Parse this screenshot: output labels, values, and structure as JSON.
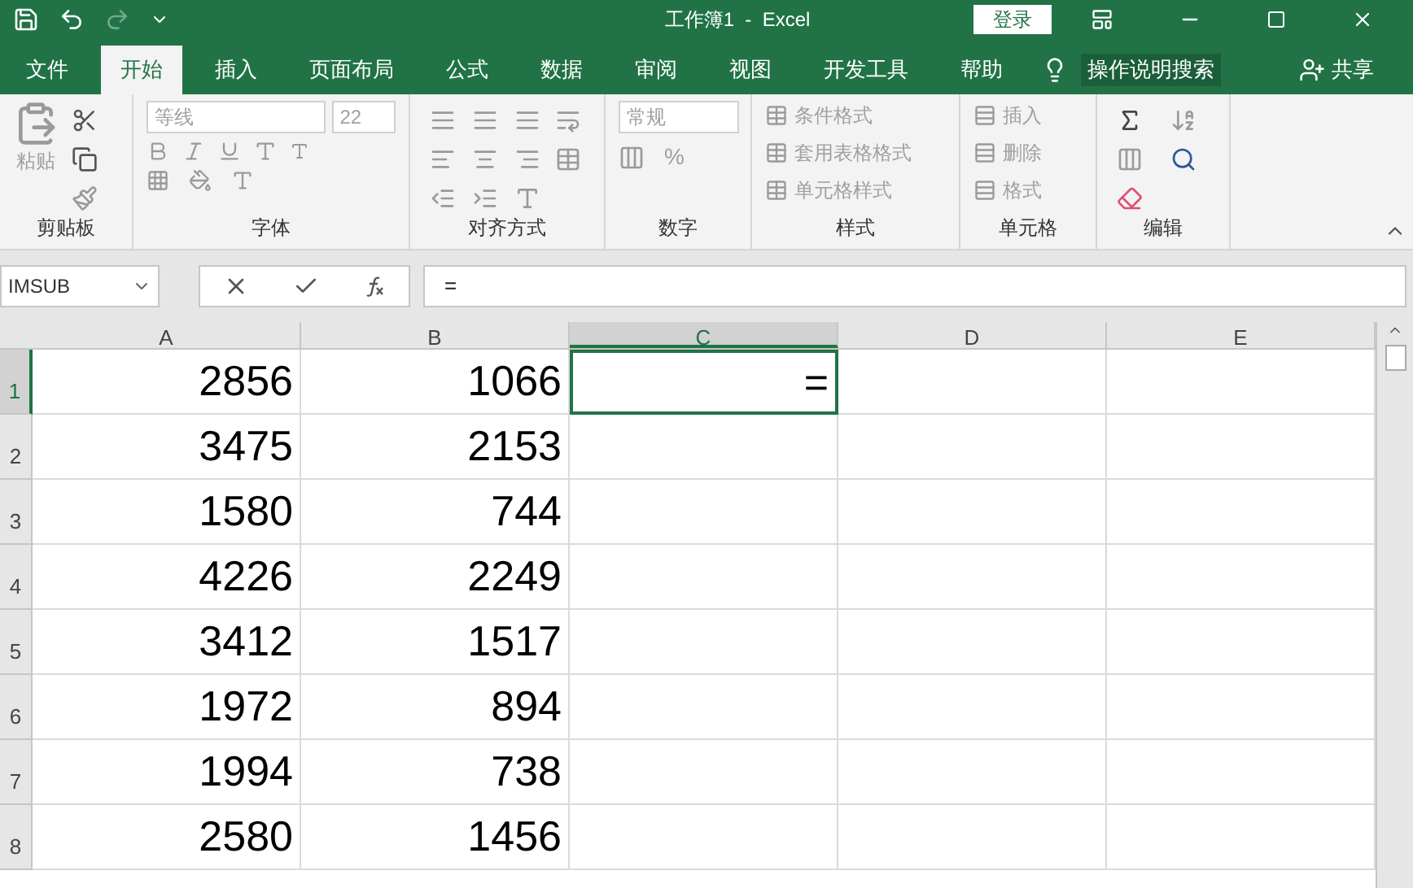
{
  "title_bar": {
    "title": "工作簿1  -  Excel",
    "signin": "登录"
  },
  "tabs": [
    {
      "label": "文件",
      "selected": false
    },
    {
      "label": "开始",
      "selected": true
    },
    {
      "label": "插入",
      "selected": false
    },
    {
      "label": "页面布局",
      "selected": false
    },
    {
      "label": "公式",
      "selected": false
    },
    {
      "label": "数据",
      "selected": false
    },
    {
      "label": "审阅",
      "selected": false
    },
    {
      "label": "视图",
      "selected": false
    },
    {
      "label": "开发工具",
      "selected": false
    },
    {
      "label": "帮助",
      "selected": false
    }
  ],
  "tell_me": "操作说明搜索",
  "share": "共享",
  "ribbon": {
    "clipboard": {
      "paste": "粘贴",
      "label": "剪贴板"
    },
    "font": {
      "font_name": "等线",
      "font_size": "22",
      "label": "字体"
    },
    "alignment": {
      "label": "对齐方式"
    },
    "number": {
      "format": "常规",
      "percent": "%",
      "label": "数字"
    },
    "styles": {
      "items": [
        "条件格式",
        "套用表格格式",
        "单元格样式"
      ],
      "label": "样式"
    },
    "cells": {
      "items": [
        "插入",
        "删除",
        "格式"
      ],
      "label": "单元格"
    },
    "editing": {
      "label": "编辑"
    }
  },
  "formula_bar": {
    "name_box": "IMSUB",
    "formula": "="
  },
  "columns": [
    {
      "label": "A",
      "selected": false
    },
    {
      "label": "B",
      "selected": false
    },
    {
      "label": "C",
      "selected": true
    },
    {
      "label": "D",
      "selected": false
    },
    {
      "label": "E",
      "selected": false
    }
  ],
  "rows": [
    {
      "number": "1",
      "selected": true,
      "cells": [
        "2856",
        "1066",
        "="
      ]
    },
    {
      "number": "2",
      "selected": false,
      "cells": [
        "3475",
        "2153"
      ]
    },
    {
      "number": "3",
      "selected": false,
      "cells": [
        "1580",
        "744"
      ]
    },
    {
      "number": "4",
      "selected": false,
      "cells": [
        "4226",
        "2249"
      ]
    },
    {
      "number": "5",
      "selected": false,
      "cells": [
        "3412",
        "1517"
      ]
    },
    {
      "number": "6",
      "selected": false,
      "cells": [
        "1972",
        "894"
      ]
    },
    {
      "number": "7",
      "selected": false,
      "cells": [
        "1994",
        "738"
      ]
    },
    {
      "number": "8",
      "selected": false,
      "cells": [
        "2580",
        "1456"
      ]
    }
  ]
}
